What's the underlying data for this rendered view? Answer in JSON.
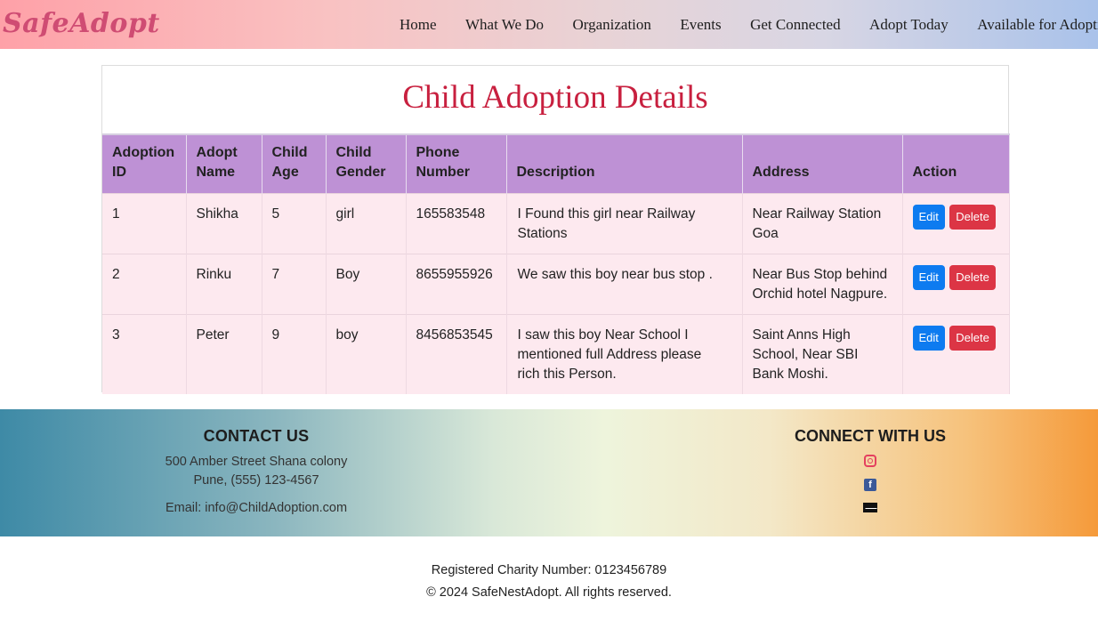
{
  "brand": "SafeAdopt",
  "nav": [
    "Home",
    "What We Do",
    "Organization",
    "Events",
    "Get Connected",
    "Adopt Today",
    "Available for Adoption"
  ],
  "page_title": "Child Adoption Details",
  "table": {
    "headers": [
      "Adoption ID",
      "Adopt Name",
      "Child Age",
      "Child Gender",
      "Phone Number",
      "Description",
      "Address",
      "Action"
    ],
    "rows": [
      {
        "id": "1",
        "name": "Shikha",
        "age": "5",
        "gender": "girl",
        "phone": "165583548",
        "description": "I Found this girl near Railway Stations",
        "address": "Near Railway Station Goa"
      },
      {
        "id": "2",
        "name": "Rinku",
        "age": "7",
        "gender": "Boy",
        "phone": "8655955926",
        "description": "We saw this boy near bus stop .",
        "address": "Near Bus Stop behind Orchid hotel Nagpure."
      },
      {
        "id": "3",
        "name": "Peter",
        "age": "9",
        "gender": "boy",
        "phone": "8456853545",
        "description": "I saw this boy Near School I mentioned full Address please rich this Person.",
        "address": "Saint Anns High School, Near SBI Bank Moshi."
      }
    ],
    "edit_label": "Edit",
    "delete_label": "Delete"
  },
  "footer": {
    "contact_title": "CONTACT US",
    "address_line1": "500 Amber Street Shana colony",
    "address_line2": "Pune, (555) 123-4567",
    "email": "Email: info@ChildAdoption.com",
    "connect_title": "CONNECT WITH US",
    "icons": [
      "instagram-icon",
      "facebook-icon",
      "email-icon"
    ]
  },
  "bottom": {
    "charity": "Registered Charity Number: 0123456789",
    "copyright": "© 2024 SafeNestAdopt. All rights reserved."
  },
  "colors": {
    "title": "#c8203f",
    "header_bg": "#be91d5",
    "row_bg": "#fde9ef",
    "edit": "#0d7bf0",
    "delete": "#dc3545"
  }
}
